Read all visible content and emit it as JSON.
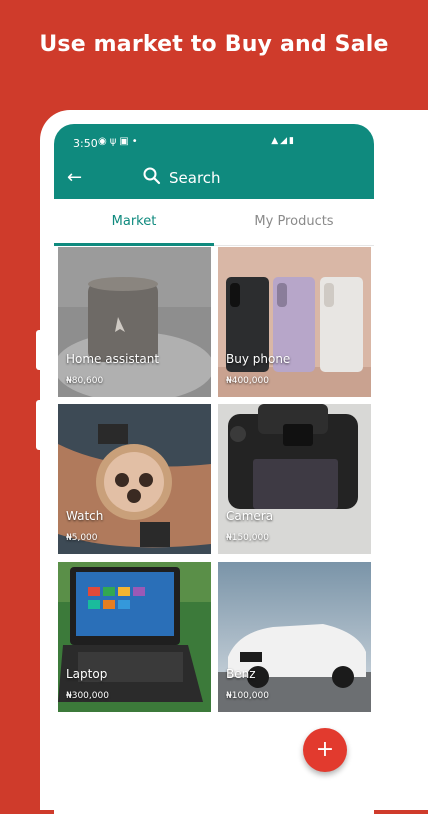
{
  "headline": "Use market to Buy and Sale",
  "status_bar": {
    "time": "3:50",
    "left_icons": [
      "whatsapp-icon",
      "usb-icon",
      "image-icon",
      "dot-icon"
    ],
    "right_icons": [
      "signal-icon",
      "wifi-icon",
      "battery-icon"
    ]
  },
  "app_bar": {
    "back_icon": "back-arrow-icon",
    "search_icon": "search-icon",
    "search_label": "Search"
  },
  "tabs": [
    {
      "label": "Market",
      "active": true
    },
    {
      "label": "My Products",
      "active": false
    }
  ],
  "products": [
    {
      "title": "Home assistant",
      "price": "₦80,600"
    },
    {
      "title": "Buy phone",
      "price": "₦400,000"
    },
    {
      "title": "Watch",
      "price": "₦5,000"
    },
    {
      "title": "Camera",
      "price": "₦150,000"
    },
    {
      "title": "Laptop",
      "price": "₦300,000"
    },
    {
      "title": "Benz",
      "price": "₦100,000"
    }
  ],
  "fab_label": "+",
  "colors": {
    "background": "#cf3b2b",
    "primary": "#0f8a7e",
    "fab": "#e23a2e"
  }
}
